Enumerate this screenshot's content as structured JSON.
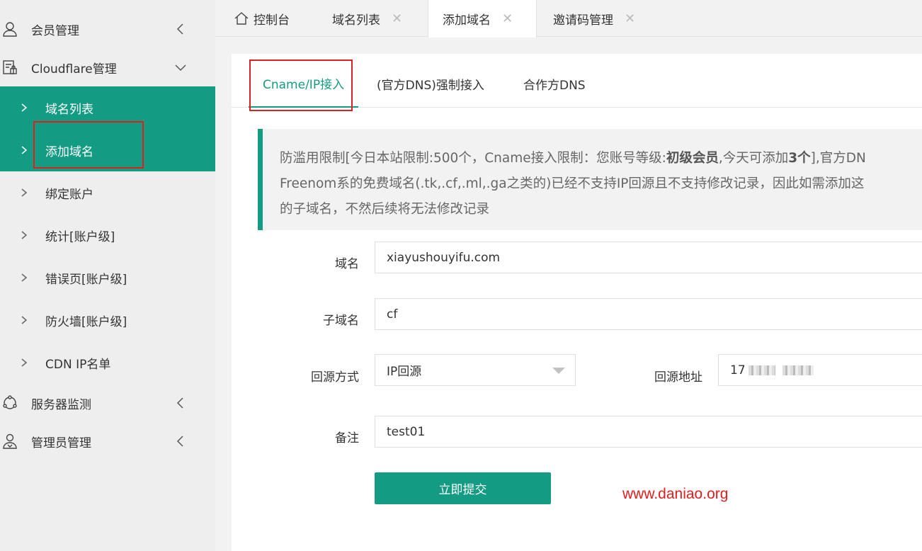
{
  "sidebar": {
    "member_mgmt": "会员管理",
    "cloudflare_mgmt": "Cloudflare管理",
    "cloudflare_items": [
      {
        "label": "域名列表"
      },
      {
        "label": "添加域名"
      },
      {
        "label": "绑定账户"
      },
      {
        "label": "统计[账户级]"
      },
      {
        "label": "错误页[账户级]"
      },
      {
        "label": "防火墙[账户级]"
      },
      {
        "label": "CDN IP名单"
      }
    ],
    "server_monitor": "服务器监测",
    "admin_mgmt": "管理员管理"
  },
  "tabs": [
    {
      "label": "控制台"
    },
    {
      "label": "域名列表"
    },
    {
      "label": "添加域名"
    },
    {
      "label": "邀请码管理"
    }
  ],
  "inner_tabs": [
    {
      "label": "Cname/IP接入"
    },
    {
      "label": "(官方DNS)强制接入"
    },
    {
      "label": "合作方DNS"
    }
  ],
  "notice": {
    "line1_a": "防滥用限制[今日本站限制:500个，Cname接入限制：您账号等级:",
    "line1_level": "初级会员",
    "line1_b": ",今天可添加",
    "line1_count": "3个",
    "line1_c": "],官方DN",
    "line2": "Freenom系的免费域名(.tk,.cf,.ml,.ga之类的)已经不支持IP回源且不支持修改记录，因此如需添加这",
    "line3": "的子域名，不然后续将无法修改记录"
  },
  "form": {
    "domain_label": "域名",
    "domain_value": "xiayushouyifu.com",
    "subdomain_label": "子域名",
    "subdomain_value": "cf",
    "origin_type_label": "回源方式",
    "origin_type_value": "IP回源",
    "origin_addr_label": "回源地址",
    "origin_addr_value": "17",
    "remark_label": "备注",
    "remark_value": "test01",
    "submit_label": "立即提交"
  },
  "watermark": "www.daniao.org",
  "colors": {
    "accent": "#139b84",
    "highlight_box": "#e02020",
    "watermark": "#e51c1c"
  }
}
